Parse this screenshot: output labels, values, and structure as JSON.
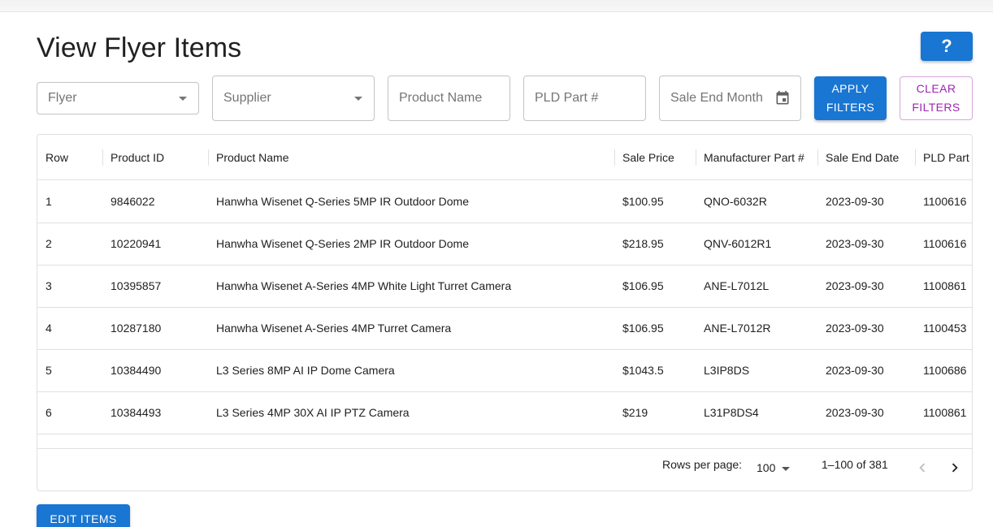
{
  "page": {
    "title": "View Flyer Items",
    "help_label": "?"
  },
  "filters": {
    "flyer": "Flyer",
    "supplier": "Supplier",
    "product_name": "Product Name",
    "pld_part": "PLD Part #",
    "sale_end_month": "Sale End Month",
    "apply_line1": "APPLY",
    "apply_line2": "FILTERS",
    "clear_line1": "CLEAR",
    "clear_line2": "FILTERS"
  },
  "table": {
    "columns": [
      "Row",
      "Product ID",
      "Product Name",
      "Sale Price",
      "Manufacturer Part #",
      "Sale End Date",
      "PLD Part"
    ],
    "rows": [
      [
        "1",
        "9846022",
        "Hanwha Wisenet Q-Series 5MP IR Outdoor Dome",
        "$100.95",
        "QNO-6032R",
        "2023-09-30",
        "1100616"
      ],
      [
        "2",
        "10220941",
        "Hanwha Wisenet Q-Series 2MP IR Outdoor Dome",
        "$218.95",
        "QNV-6012R1",
        "2023-09-30",
        "1100616"
      ],
      [
        "3",
        "10395857",
        "Hanwha Wisenet A-Series 4MP White Light Turret Camera",
        "$106.95",
        "ANE-L7012L",
        "2023-09-30",
        "1100861"
      ],
      [
        "4",
        "10287180",
        "Hanwha Wisenet A-Series 4MP Turret Camera",
        "$106.95",
        "ANE-L7012R",
        "2023-09-30",
        "1100453"
      ],
      [
        "5",
        "10384490",
        "L3 Series 8MP AI IP Dome Camera",
        "$1043.5",
        "L3IP8DS",
        "2023-09-30",
        "1100686"
      ],
      [
        "6",
        "10384493",
        "L3 Series 4MP 30X AI IP PTZ Camera",
        "$219",
        "L31P8DS4",
        "2023-09-30",
        "1100861"
      ]
    ]
  },
  "pagination": {
    "rows_per_page_label": "Rows per page:",
    "rows_per_page_value": "100",
    "range_text": "1–100 of 381"
  },
  "actions": {
    "edit_items": "EDIT ITEMS"
  }
}
